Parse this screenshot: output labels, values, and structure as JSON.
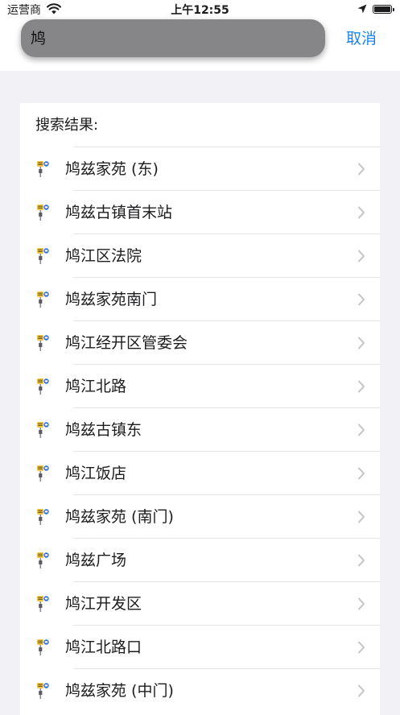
{
  "status_bar": {
    "carrier": "运营商",
    "time": "上午12:55"
  },
  "search": {
    "value": "鸠",
    "cancel_label": "取消"
  },
  "results": {
    "label": "搜索结果:",
    "items": [
      {
        "name": "鸠兹家苑 (东)"
      },
      {
        "name": "鸠兹古镇首末站"
      },
      {
        "name": "鸠江区法院"
      },
      {
        "name": "鸠兹家苑南门"
      },
      {
        "name": "鸠江经开区管委会"
      },
      {
        "name": "鸠江北路"
      },
      {
        "name": "鸠兹古镇东"
      },
      {
        "name": "鸠江饭店"
      },
      {
        "name": "鸠兹家苑 (南门)"
      },
      {
        "name": "鸠兹广场"
      },
      {
        "name": "鸠江开发区"
      },
      {
        "name": "鸠江北路口"
      },
      {
        "name": "鸠兹家苑 (中门)"
      }
    ]
  },
  "colors": {
    "accent": "#1a84f0",
    "search_bg": "#868688",
    "page_bg": "#f2f2f6"
  },
  "icons": {
    "row_icon": "bus-stop-icon",
    "row_chevron": "chevron-right-icon",
    "status": [
      "wifi-icon",
      "location-arrow-icon",
      "battery-icon"
    ]
  }
}
